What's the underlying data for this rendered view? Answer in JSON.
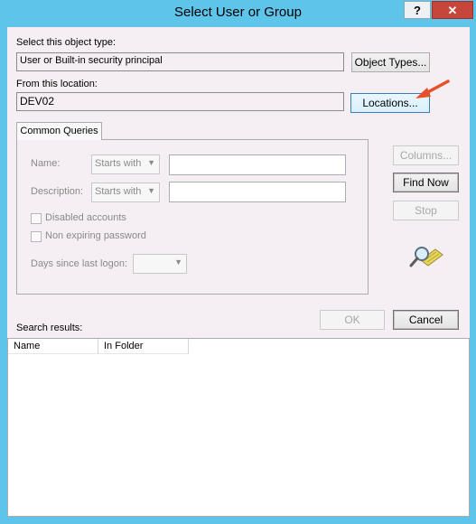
{
  "window": {
    "title": "Select User or Group",
    "help_label": "?",
    "close_label": "✕"
  },
  "object_type": {
    "label": "Select this object type:",
    "value": "User or Built-in security principal",
    "button": "Object Types..."
  },
  "location": {
    "label": "From this location:",
    "value": "DEV02",
    "button": "Locations..."
  },
  "queries": {
    "tab_label": "Common Queries",
    "name_label": "Name:",
    "name_mode": "Starts with",
    "description_label": "Description:",
    "description_mode": "Starts with",
    "disabled_accounts_label": "Disabled accounts",
    "non_expiring_label": "Non expiring password",
    "days_label": "Days since last logon:",
    "days_value": ""
  },
  "side_buttons": {
    "columns": "Columns...",
    "find_now": "Find Now",
    "stop": "Stop"
  },
  "dialog_buttons": {
    "ok": "OK",
    "cancel": "Cancel"
  },
  "results": {
    "label": "Search results:",
    "columns": [
      "Name",
      "In Folder"
    ],
    "rows": []
  },
  "colors": {
    "title_bar": "#5fc4e9",
    "dialog_bg": "#f5eef2",
    "close_button": "#c7463b",
    "annotation_arrow": "#e8502a"
  },
  "icons": {
    "search": "magnifier-over-directory-icon",
    "annotation": "red-arrow-annotation"
  }
}
